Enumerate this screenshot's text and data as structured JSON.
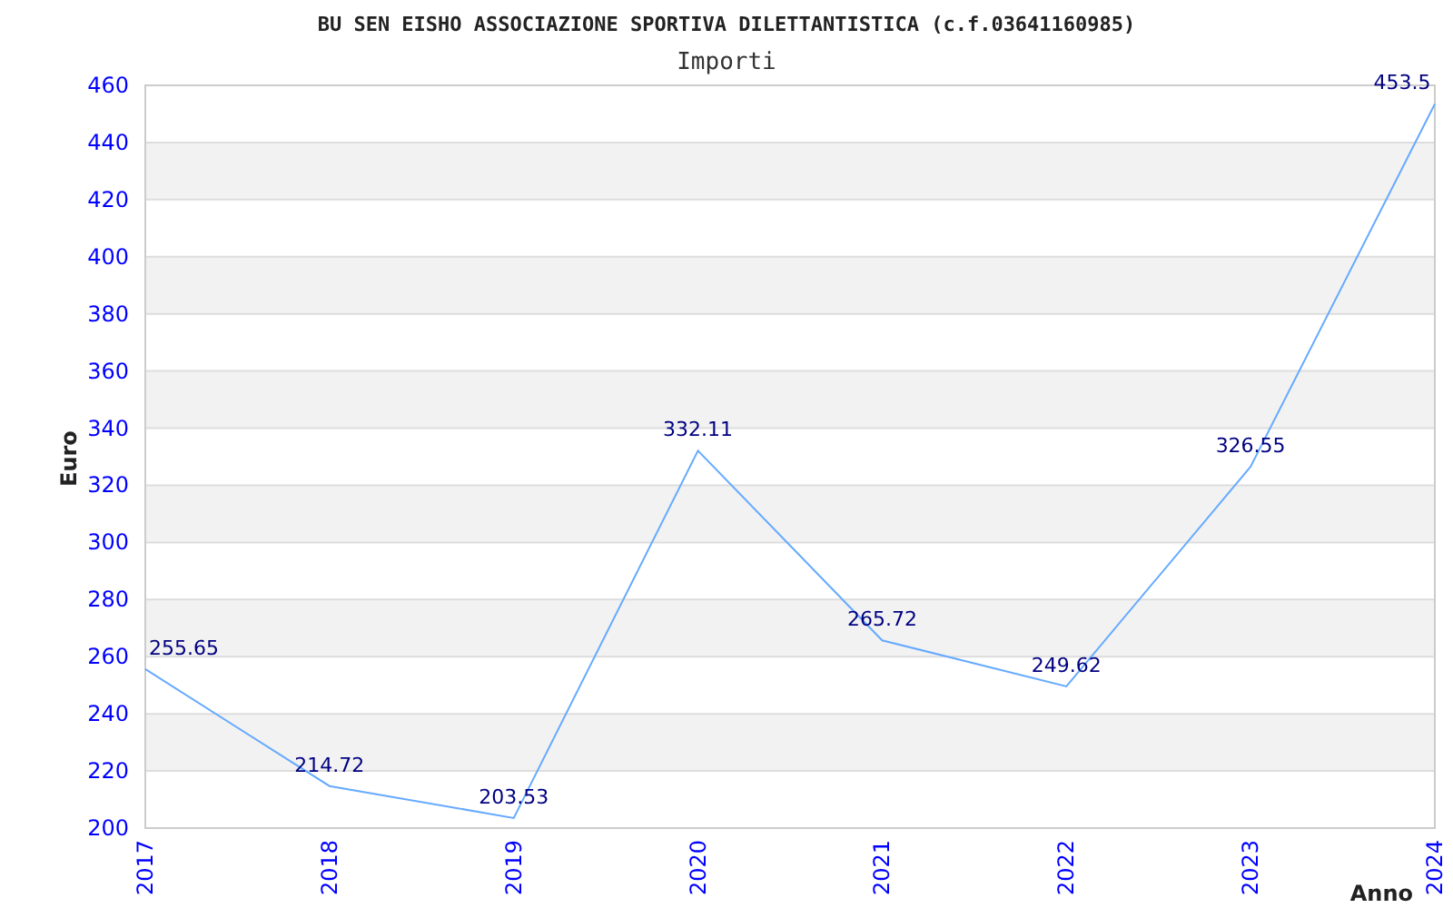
{
  "page_title": "BU SEN EISHO ASSOCIAZIONE SPORTIVA DILETTANTISTICA (c.f.03641160985)",
  "chart_data": {
    "type": "line",
    "title": "Importi",
    "xlabel": "Anno",
    "ylabel": "Euro",
    "categories": [
      "2017",
      "2018",
      "2019",
      "2020",
      "2021",
      "2022",
      "2023",
      "2024"
    ],
    "grid": true,
    "series": [
      {
        "color": "#66aaff",
        "values": [
          255.65,
          214.72,
          203.53,
          332.11,
          265.72,
          249.62,
          326.55,
          453.5
        ]
      }
    ],
    "value_labels": [
      "255.65",
      "214.72",
      "203.53",
      "332.11",
      "265.72",
      "249.62",
      "326.55",
      "453.5"
    ],
    "ylim": [
      200,
      460
    ],
    "yticks": [
      200,
      220,
      240,
      260,
      280,
      300,
      320,
      340,
      360,
      380,
      400,
      420,
      440,
      460
    ]
  }
}
